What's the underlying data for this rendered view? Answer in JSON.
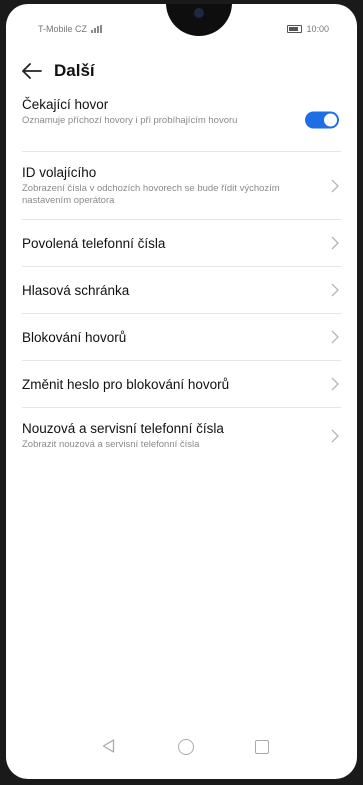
{
  "status_bar": {
    "carrier": "T-Mobile CZ",
    "time": "10:00"
  },
  "header": {
    "title": "Další"
  },
  "settings": [
    {
      "title": "Čekající hovor",
      "subtitle": "Oznamuje příchozí hovory i při probíhajícím hovoru",
      "control": "toggle",
      "toggle_on": true
    },
    {
      "title": "ID volajícího",
      "subtitle": "Zobrazení čísla v odchozích hovorech se bude řídit výchozím nastavením operátora",
      "control": "chevron"
    },
    {
      "title": "Povolená telefonní čísla",
      "control": "chevron"
    },
    {
      "title": "Hlasová schránka",
      "control": "chevron"
    },
    {
      "title": "Blokování hovorů",
      "control": "chevron"
    },
    {
      "title": "Změnit heslo pro blokování hovorů",
      "control": "chevron"
    },
    {
      "title": "Nouzová a servisní telefonní čísla",
      "subtitle": "Zobrazit nouzová a servisní telefonní čísla",
      "control": "chevron"
    }
  ],
  "colors": {
    "accent": "#1e6ee6",
    "text": "#111111",
    "subtext": "#8a8a8a",
    "divider": "#e6e6e6"
  },
  "icons": {
    "back": "arrow-left-icon",
    "chevron": "chevron-right-icon",
    "nav_back": "triangle-back-icon",
    "nav_home": "circle-home-icon",
    "nav_recent": "square-recents-icon"
  }
}
